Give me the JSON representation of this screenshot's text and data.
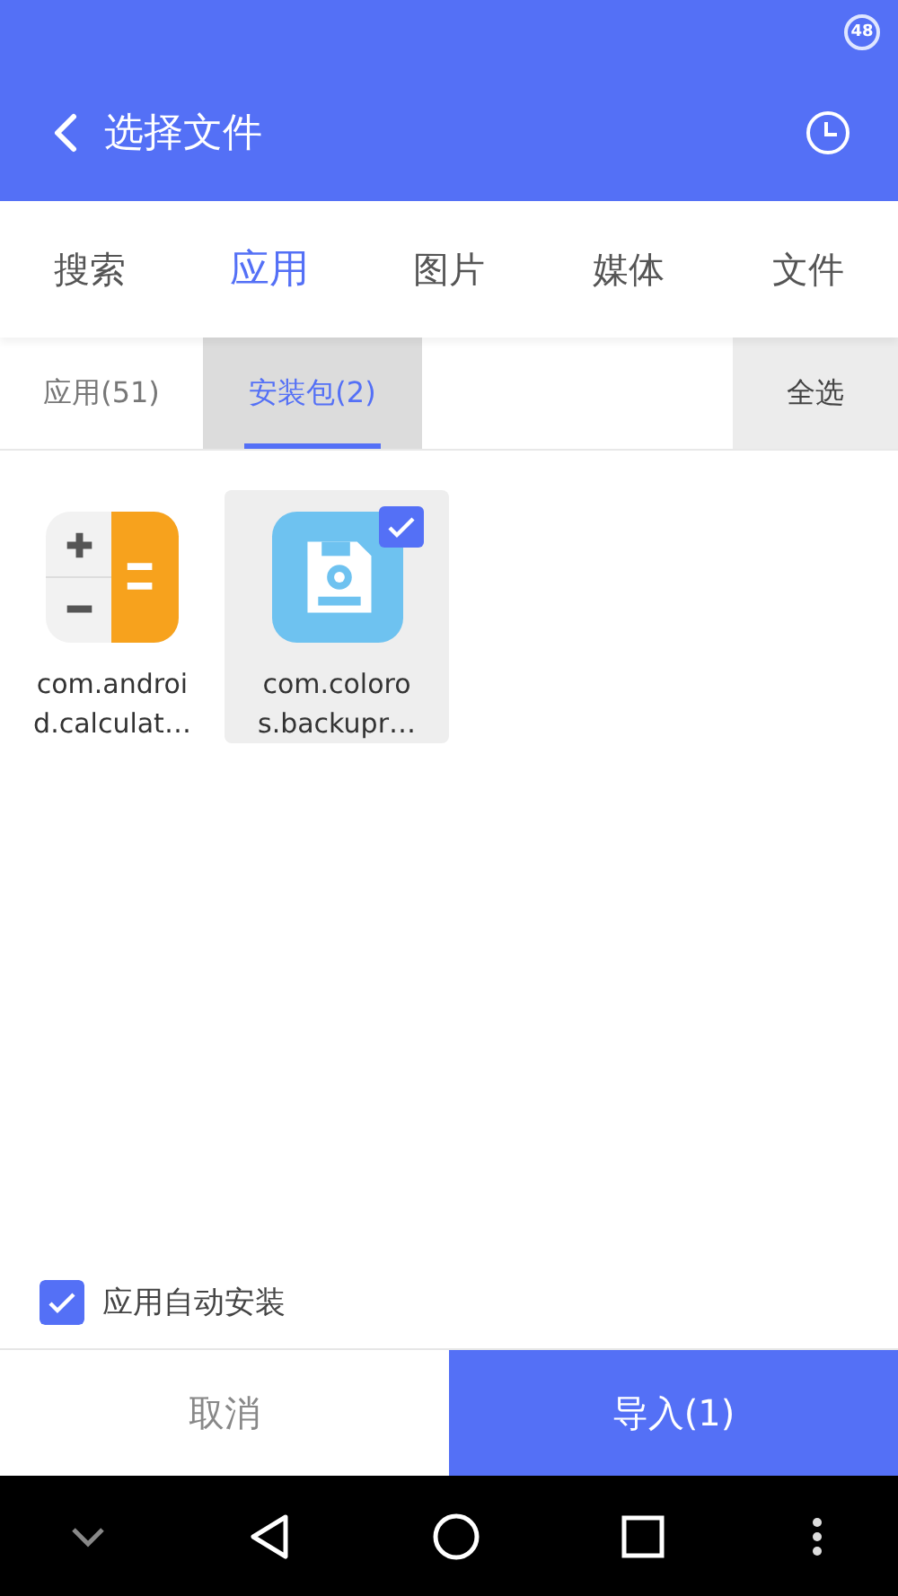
{
  "status_bar": {
    "badge": "48"
  },
  "header": {
    "title": "选择文件"
  },
  "tabs": [
    {
      "label": "搜索",
      "selected": false
    },
    {
      "label": "应用",
      "selected": true
    },
    {
      "label": "图片",
      "selected": false
    },
    {
      "label": "媒体",
      "selected": false
    },
    {
      "label": "文件",
      "selected": false
    }
  ],
  "sub_tabs": [
    {
      "label": "应用(51)",
      "selected": false
    },
    {
      "label": "安装包(2)",
      "selected": true
    }
  ],
  "select_all": "全选",
  "files": [
    {
      "kind": "calculator",
      "name_lines": [
        "com.androi",
        "d.calculat…"
      ],
      "selected": false
    },
    {
      "kind": "backup",
      "name_lines": [
        "com.coloro",
        "s.backupr…"
      ],
      "selected": true
    }
  ],
  "auto_install": {
    "label": "应用自动安装",
    "checked": true
  },
  "buttons": [
    {
      "kind": "secondary",
      "label": "取消"
    },
    {
      "kind": "primary",
      "label": "导入(1)"
    }
  ]
}
